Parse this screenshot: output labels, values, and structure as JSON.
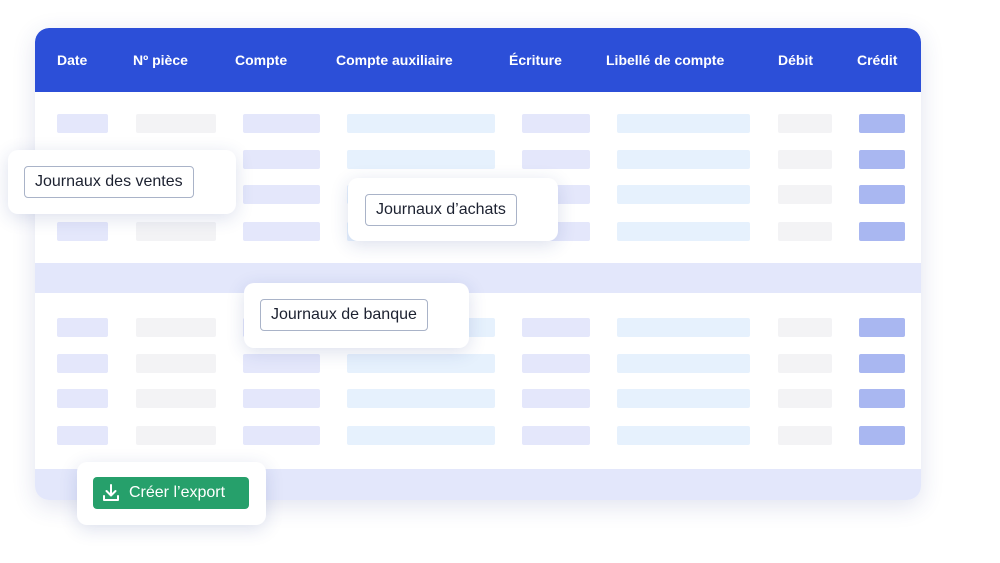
{
  "table": {
    "columns": [
      "Date",
      "Nº pièce",
      "Compte",
      "Compte auxiliaire",
      "Écriture",
      "Libellé de compte",
      "Débit",
      "Crédit"
    ]
  },
  "popups": {
    "sales_journal": "Journaux des ventes",
    "purchase_journal": "Journaux d’achats",
    "bank_journal": "Journaux de banque"
  },
  "export": {
    "label": "Créer l’export",
    "icon": "download-icon"
  },
  "colors": {
    "header": "#2c4fd8",
    "band": "#e3e7fb",
    "placeholder_lavender": "#e4e7fb",
    "placeholder_gray": "#f3f3f5",
    "placeholder_ice": "#e6f1fd",
    "placeholder_credit": "#a9b7f1",
    "export_button": "#26a06b"
  }
}
